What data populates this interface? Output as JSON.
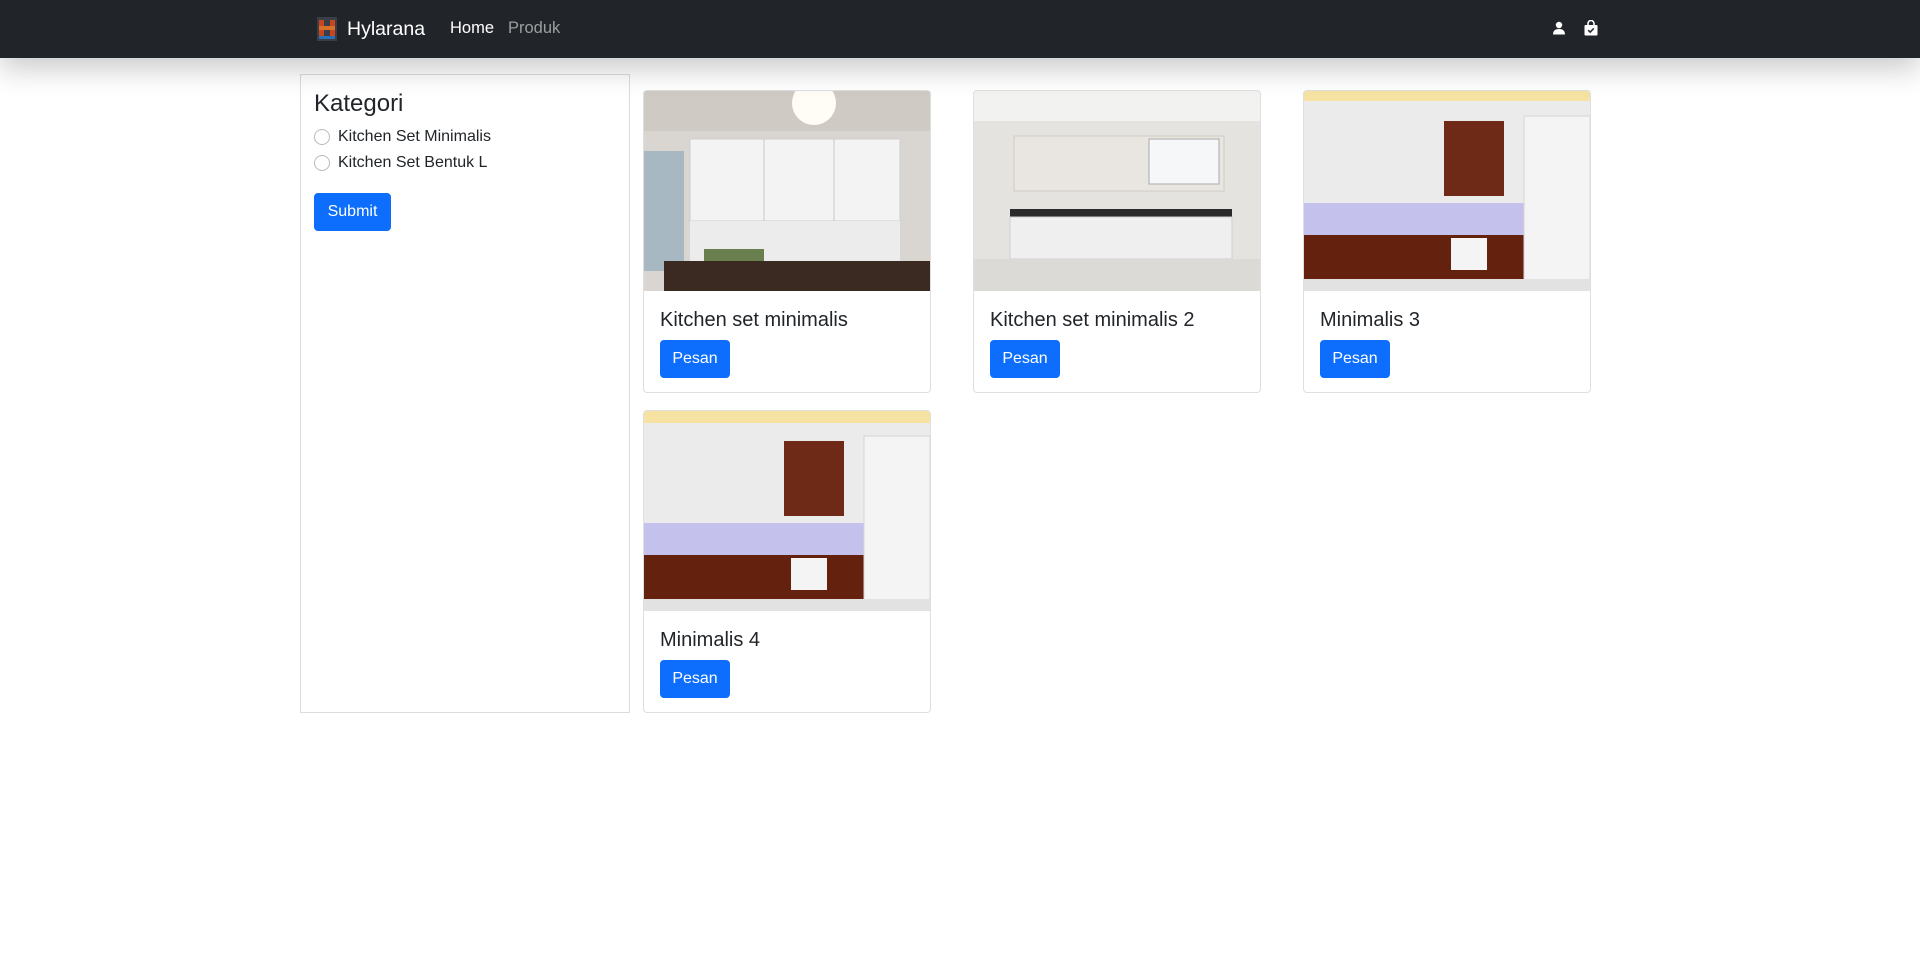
{
  "navbar": {
    "brand": "Hylarana",
    "links": [
      {
        "label": "Home",
        "active": true
      },
      {
        "label": "Produk",
        "active": false
      }
    ],
    "icons": [
      "user-icon",
      "shopping-bag-icon"
    ],
    "background": "#212529"
  },
  "sidebar": {
    "title": "Kategori",
    "options": [
      {
        "label": "Kitchen Set Minimalis",
        "checked": false
      },
      {
        "label": "Kitchen Set Bentuk L",
        "checked": false
      }
    ],
    "submit_label": "Submit"
  },
  "products": [
    {
      "title": "Kitchen set minimalis",
      "button": "Pesan",
      "image": "kitchen-photo"
    },
    {
      "title": "Kitchen set minimalis 2",
      "button": "Pesan",
      "image": "kitchen-photo"
    },
    {
      "title": "Minimalis 3",
      "button": "Pesan",
      "image": "kitchen-photo"
    },
    {
      "title": "Minimalis 4",
      "button": "Pesan",
      "image": "kitchen-photo"
    }
  ],
  "colors": {
    "primary": "#0d6efd",
    "navbar": "#212529",
    "border": "#dcdcdc"
  }
}
